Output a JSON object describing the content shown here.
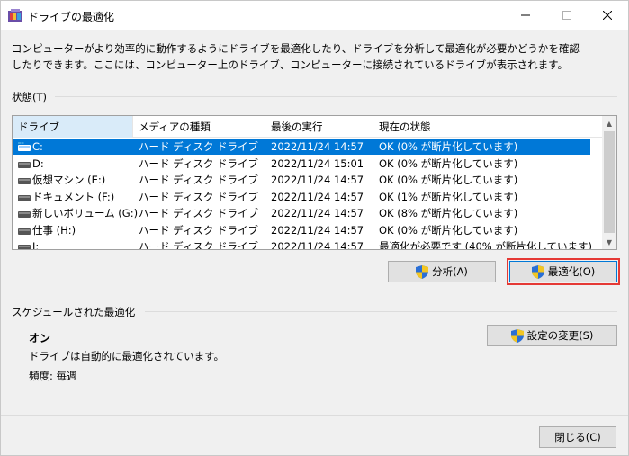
{
  "window": {
    "title": "ドライブの最適化",
    "minimize": "—",
    "maximize": "☐",
    "close": "✕"
  },
  "description": "コンピューターがより効率的に動作するようにドライブを最適化したり、ドライブを分析して最適化が必要かどうかを確認したりできます。ここには、コンピューター上のドライブ、コンピューターに接続されているドライブが表示されます。",
  "status_group": {
    "label": "状態(T)"
  },
  "table": {
    "columns": [
      "ドライブ",
      "メディアの種類",
      "最後の実行",
      "現在の状態"
    ],
    "rows": [
      {
        "drive": "C:",
        "media": "ハード ディスク ドライブ",
        "last_run": "2022/11/24 14:57",
        "status": "OK (0% が断片化しています)",
        "selected": true
      },
      {
        "drive": "D:",
        "media": "ハード ディスク ドライブ",
        "last_run": "2022/11/24 15:01",
        "status": "OK (0% が断片化しています)",
        "selected": false
      },
      {
        "drive": "仮想マシン (E:)",
        "media": "ハード ディスク ドライブ",
        "last_run": "2022/11/24 14:57",
        "status": "OK (0% が断片化しています)",
        "selected": false
      },
      {
        "drive": "ドキュメント (F:)",
        "media": "ハード ディスク ドライブ",
        "last_run": "2022/11/24 14:57",
        "status": "OK (1% が断片化しています)",
        "selected": false
      },
      {
        "drive": "新しいボリューム (G:)",
        "media": "ハード ディスク ドライブ",
        "last_run": "2022/11/24 14:57",
        "status": "OK (8% が断片化しています)",
        "selected": false
      },
      {
        "drive": "仕事 (H:)",
        "media": "ハード ディスク ドライブ",
        "last_run": "2022/11/24 14:57",
        "status": "OK (0% が断片化しています)",
        "selected": false
      },
      {
        "drive": "I:",
        "media": "ハード ディスク ドライブ",
        "last_run": "2022/11/24 14:57",
        "status": "最適化が必要です (40% が断片化しています)",
        "selected": false
      }
    ]
  },
  "buttons": {
    "analyze": "分析(A)",
    "optimize": "最適化(O)",
    "change_settings": "設定の変更(S)",
    "close": "閉じる(C)"
  },
  "schedule": {
    "label": "スケジュールされた最適化",
    "state": "オン",
    "detail": "ドライブは自動的に最適化されています。",
    "frequency": "頻度: 毎週"
  },
  "colors": {
    "selection": "#0078d7",
    "highlight_outline": "#e53935"
  },
  "icons": {
    "app": "defrag-icon",
    "drive": "hard-drive-icon",
    "shield": "uac-shield-icon"
  }
}
